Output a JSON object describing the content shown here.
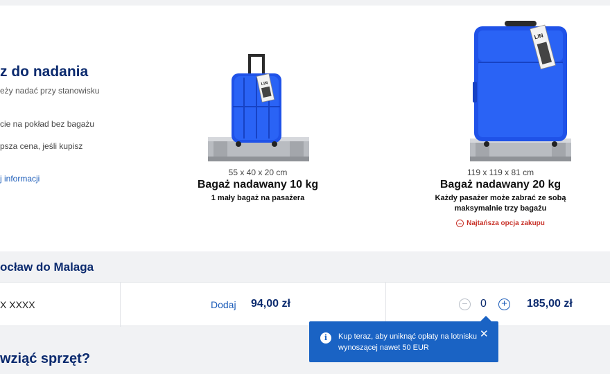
{
  "section": {
    "title": "z do nadania",
    "subtitle": "eży nadać przy stanowisku",
    "bullet1": "cie na pokład bez bagażu",
    "bullet2": "psza cena, jeśli kupisz",
    "more_link": "j informacji"
  },
  "bags": [
    {
      "dims": "55 x 40 x 20 cm",
      "name": "Bagaż nadawany 10 kg",
      "desc": "1 mały bagaż na pasażera",
      "tag": "LIN"
    },
    {
      "dims": "119 x 119 x 81 cm",
      "name": "Bagaż nadawany 20 kg",
      "desc": "Każdy pasażer może zabrać ze sobą maksymalnie trzy bagażu",
      "cheapest": "Najtańsza opcja zakupu",
      "tag": "LIN"
    }
  ],
  "route": {
    "title": "ocław do Malaga"
  },
  "passenger": {
    "name": "X XXXX",
    "add_label": "Dodaj",
    "price_small": "94,00 zł",
    "quantity": "0",
    "price_large": "185,00 zł"
  },
  "bottom": {
    "title": "wziąć sprzęt?"
  },
  "tooltip": {
    "text": "Kup teraz, aby uniknąć opłaty na lotnisku wynoszącej nawet 50 EUR",
    "close": "✕"
  },
  "colors": {
    "suitcase_blue": "#1f52e8",
    "brand_navy": "#0b2a6e",
    "link_blue": "#1a5bb8",
    "alert_red": "#c8332a",
    "tooltip_bg": "#1a63c4"
  }
}
